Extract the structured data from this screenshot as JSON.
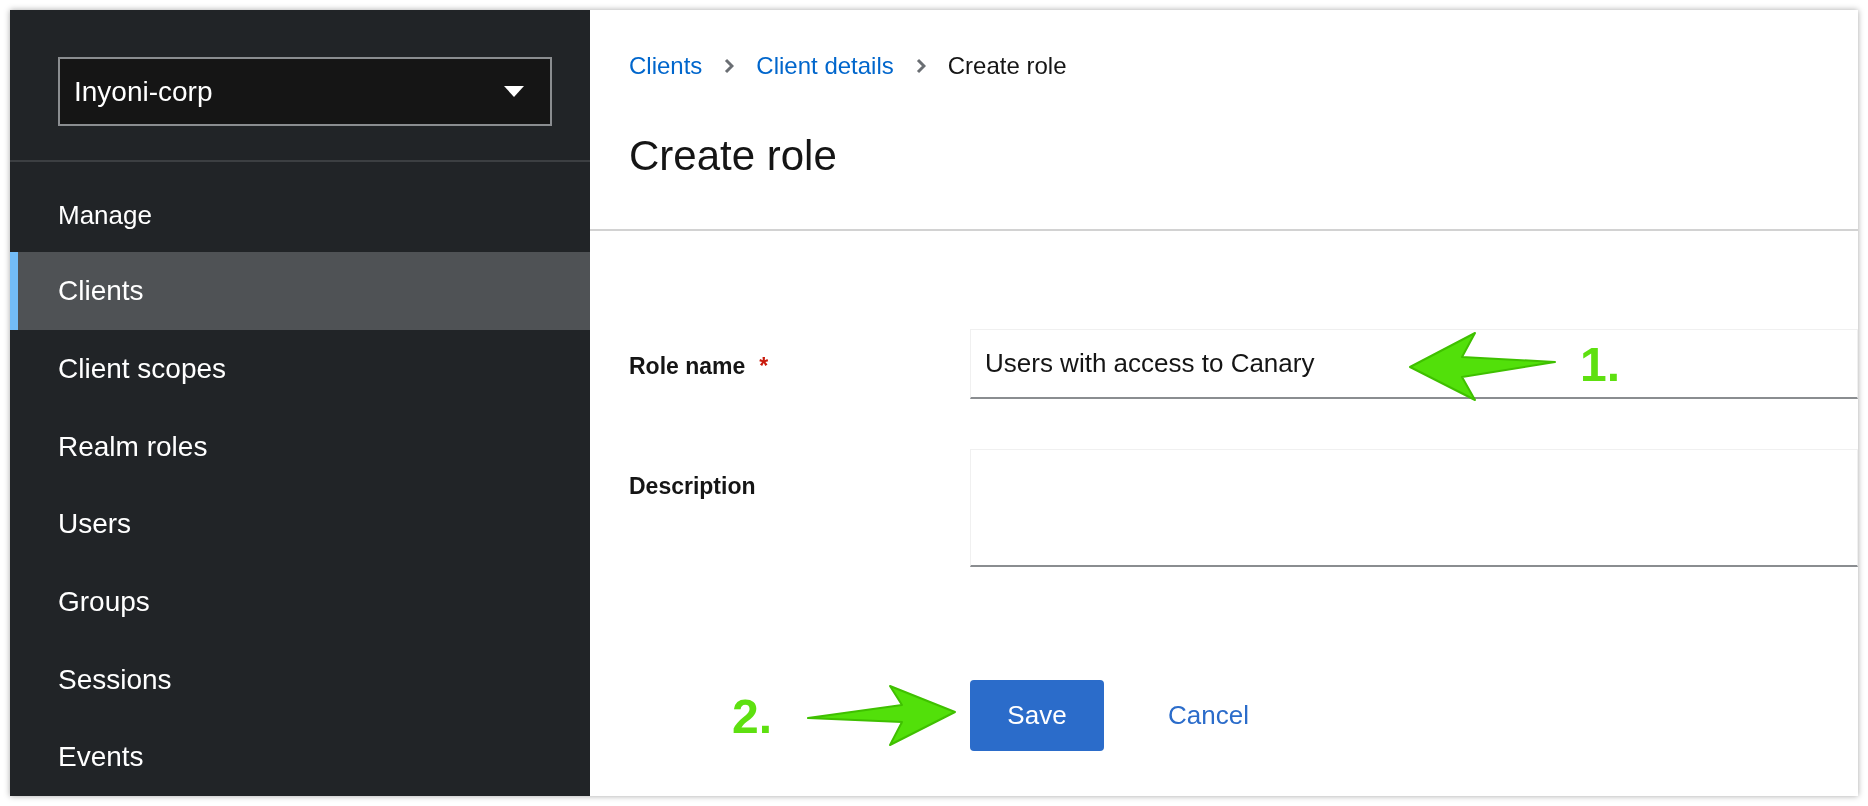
{
  "sidebar": {
    "realm_selector": {
      "value": "Inyoni-corp"
    },
    "section_title": "Manage",
    "items": [
      {
        "label": "Clients",
        "selected": true
      },
      {
        "label": "Client scopes",
        "selected": false
      },
      {
        "label": "Realm roles",
        "selected": false
      },
      {
        "label": "Users",
        "selected": false
      },
      {
        "label": "Groups",
        "selected": false
      },
      {
        "label": "Sessions",
        "selected": false
      },
      {
        "label": "Events",
        "selected": false
      }
    ]
  },
  "breadcrumb": [
    {
      "label": "Clients",
      "kind": "link"
    },
    {
      "label": "Client details",
      "kind": "link"
    },
    {
      "label": "Create role",
      "kind": "current"
    }
  ],
  "page_title": "Create role",
  "form": {
    "required_mark": "*",
    "fields": [
      {
        "label": "Role name",
        "required": true,
        "kind": "input",
        "value": "Users with access to Canary"
      },
      {
        "label": "Description",
        "required": false,
        "kind": "textarea"
      }
    ]
  },
  "buttons": [
    {
      "label": "Save",
      "kind": "primary"
    },
    {
      "label": "Cancel",
      "kind": "link"
    }
  ],
  "annotations": [
    {
      "label": "1."
    },
    {
      "label": "2."
    }
  ]
}
